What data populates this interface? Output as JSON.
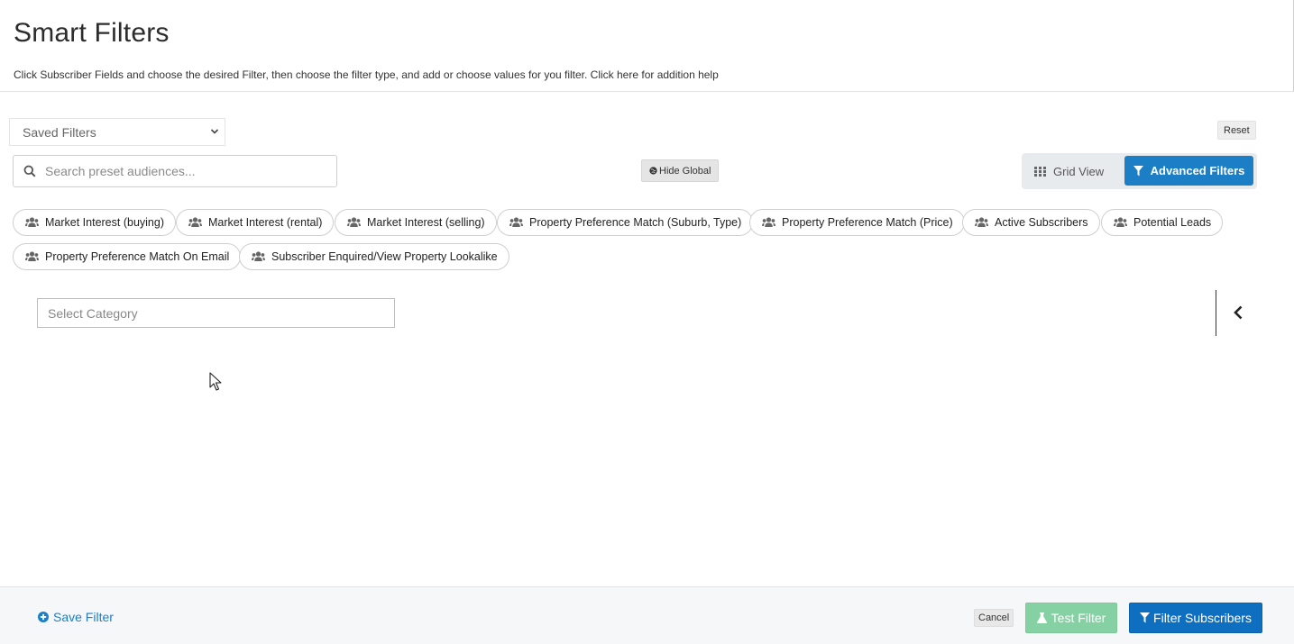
{
  "header": {
    "title": "Smart Filters",
    "subtitle": "Click Subscriber Fields and choose the desired Filter, then choose the filter type, and add or choose values for you filter. Click here for addition help"
  },
  "saved_filters": {
    "selected": "Saved Filters"
  },
  "reset_label": "Reset",
  "search": {
    "placeholder": "Search preset audiences..."
  },
  "hide_global_label": "Hide Global",
  "view_toggle": {
    "grid_label": "Grid View",
    "advanced_label": "Advanced Filters",
    "active": "Advanced Filters",
    "active_color": "#1c7fc6"
  },
  "presets": [
    {
      "label": "Market Interest (buying)",
      "icon": "users-icon"
    },
    {
      "label": "Market Interest (rental)",
      "icon": "users-icon"
    },
    {
      "label": "Market Interest (selling)",
      "icon": "users-icon"
    },
    {
      "label": "Property Preference Match (Suburb, Type)",
      "icon": "users-icon"
    },
    {
      "label": "Property Preference Match (Price)",
      "icon": "users-icon"
    },
    {
      "label": "Active Subscribers",
      "icon": "users-icon"
    },
    {
      "label": "Potential Leads",
      "icon": "users-icon"
    },
    {
      "label": "Property Preference Match On Email",
      "icon": "users-icon"
    },
    {
      "label": "Subscriber Enquired/View Property Lookalike",
      "icon": "users-icon"
    }
  ],
  "category_select": {
    "placeholder": "Select Category"
  },
  "footer": {
    "save_filter_label": "Save Filter",
    "cancel_label": "Cancel",
    "test_filter_label": "Test Filter",
    "filter_subscribers_label": "Filter Subscribers",
    "primary_color": "#0e6fc0",
    "test_color": "#86d1a3"
  }
}
